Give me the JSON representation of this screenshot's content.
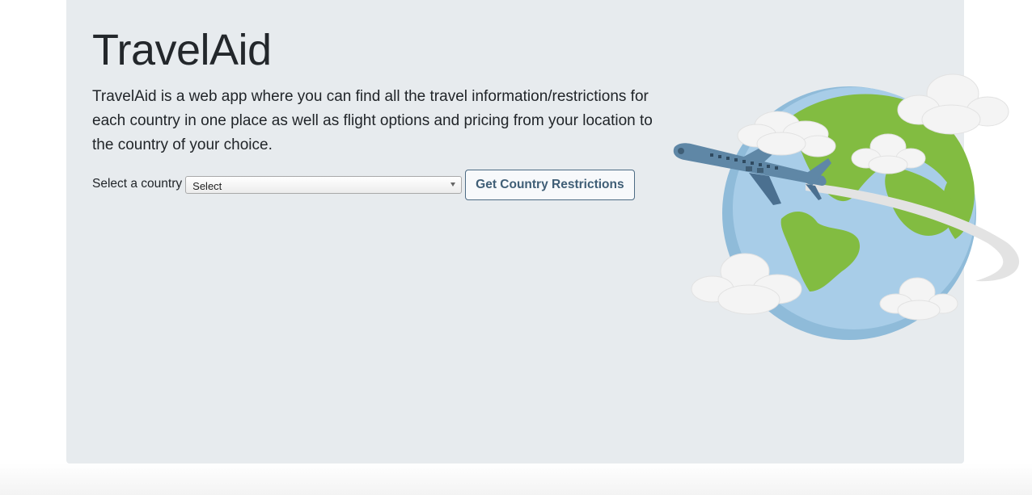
{
  "header": {
    "title": "TravelAid",
    "description": "TravelAid is a web app where you can find all the travel information/restrictions for each country in one place as well as flight options and pricing from your location to the country of your choice."
  },
  "form": {
    "label": "Select a country",
    "select_value": "Select",
    "button_label": "Get Country Restrictions"
  },
  "illustration": {
    "icon": "globe-with-airplane-illustration"
  },
  "colors": {
    "jumbotron_bg": "#e7ebee",
    "button_text": "#3f5e76",
    "button_border": "#4d6b84",
    "ocean": "#a8cde8",
    "land": "#82bc41",
    "plane": "#5f87a6",
    "cloud": "#f4f4f4"
  }
}
